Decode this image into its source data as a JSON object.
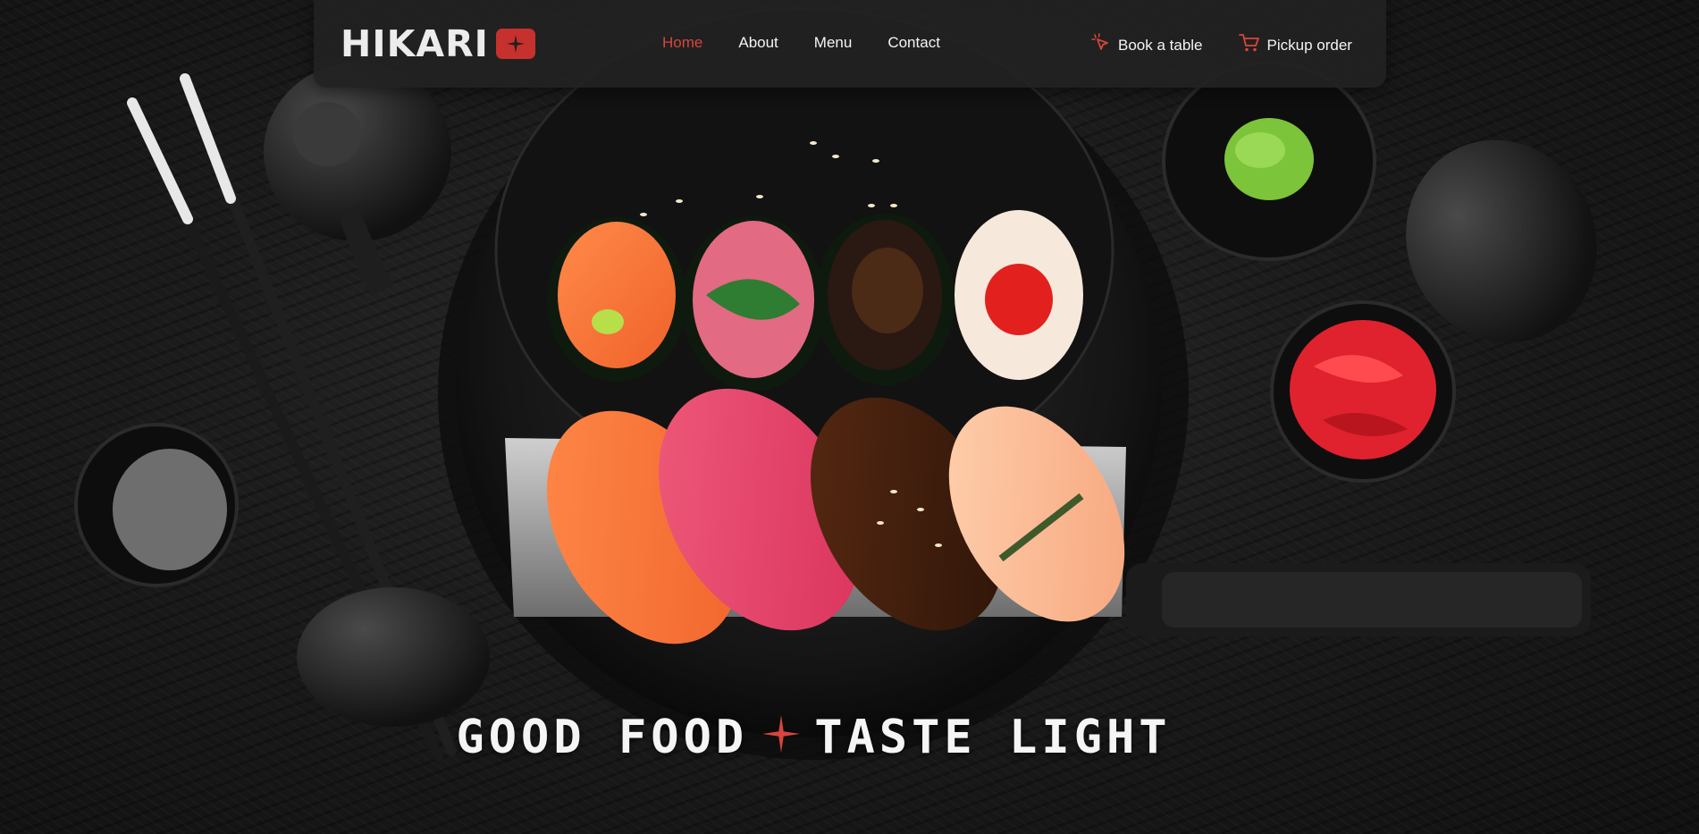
{
  "brand": {
    "name": "HIKARI",
    "accent": "#c6312d"
  },
  "nav": {
    "links": [
      {
        "label": "Home",
        "active": true
      },
      {
        "label": "About",
        "active": false
      },
      {
        "label": "Menu",
        "active": false
      },
      {
        "label": "Contact",
        "active": false
      }
    ],
    "active_color": "#d9453c"
  },
  "actions": {
    "book": {
      "label": "Book a table",
      "icon": "pointer-click-icon"
    },
    "pickup": {
      "label": "Pickup order",
      "icon": "cart-icon"
    }
  },
  "hero": {
    "tagline_left": "GOOD FOOD",
    "tagline_right": "TASTE LIGHT",
    "separator_icon": "sparkle-icon"
  }
}
